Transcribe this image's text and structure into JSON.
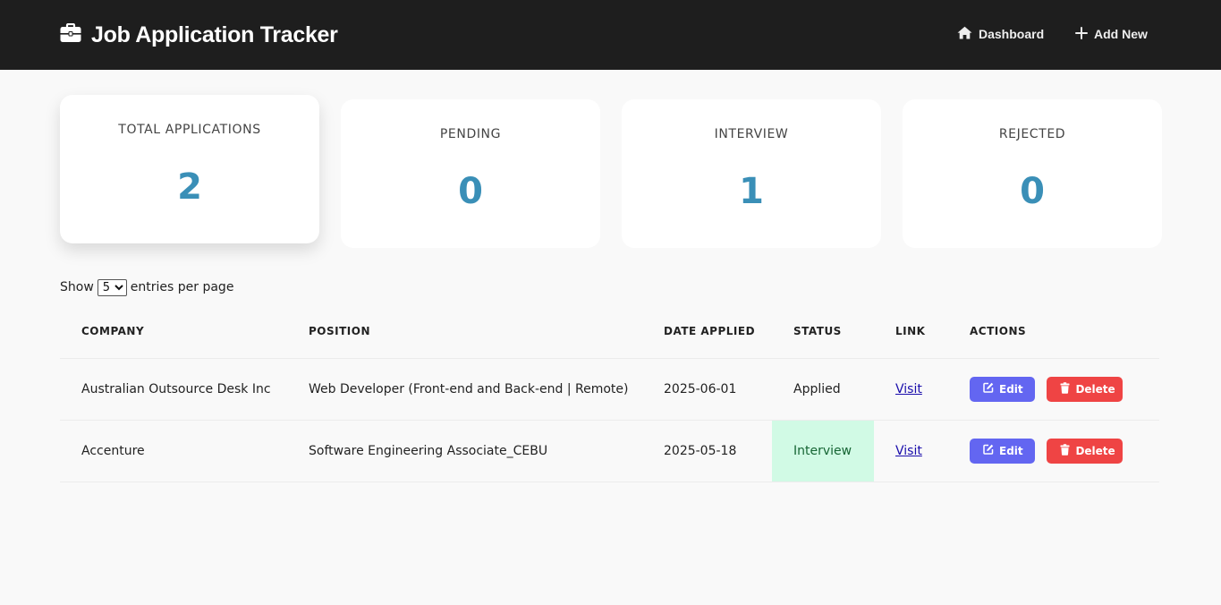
{
  "header": {
    "title": "Job Application Tracker",
    "brand_icon": "briefcase-icon",
    "nav": [
      {
        "label": "Dashboard",
        "icon": "home-icon"
      },
      {
        "label": "Add New",
        "icon": "plus-icon"
      }
    ]
  },
  "stats": [
    {
      "label": "TOTAL APPLICATIONS",
      "value": "2"
    },
    {
      "label": "PENDING",
      "value": "0"
    },
    {
      "label": "INTERVIEW",
      "value": "1"
    },
    {
      "label": "REJECTED",
      "value": "0"
    }
  ],
  "entries": {
    "prefix": "Show",
    "selected": "5",
    "suffix": "entries per page"
  },
  "table": {
    "columns": [
      "COMPANY",
      "POSITION",
      "DATE APPLIED",
      "STATUS",
      "LINK",
      "ACTIONS"
    ],
    "rows": [
      {
        "company": "Australian Outsource Desk Inc",
        "position": "Web Developer (Front-end and Back-end | Remote)",
        "date": "2025-06-01",
        "status": "Applied",
        "link": "Visit",
        "edit": "Edit",
        "delete": "Delete"
      },
      {
        "company": "Accenture",
        "position": "Software Engineering Associate_CEBU",
        "date": "2025-05-18",
        "status": "Interview",
        "link": "Visit",
        "edit": "Edit",
        "delete": "Delete"
      }
    ]
  },
  "colors": {
    "header_bg": "#1e1e1e",
    "stat_value": "#3a8fb7",
    "edit_button": "#6366f1",
    "delete_button": "#ef4444",
    "interview_highlight": "#d1fae5"
  }
}
